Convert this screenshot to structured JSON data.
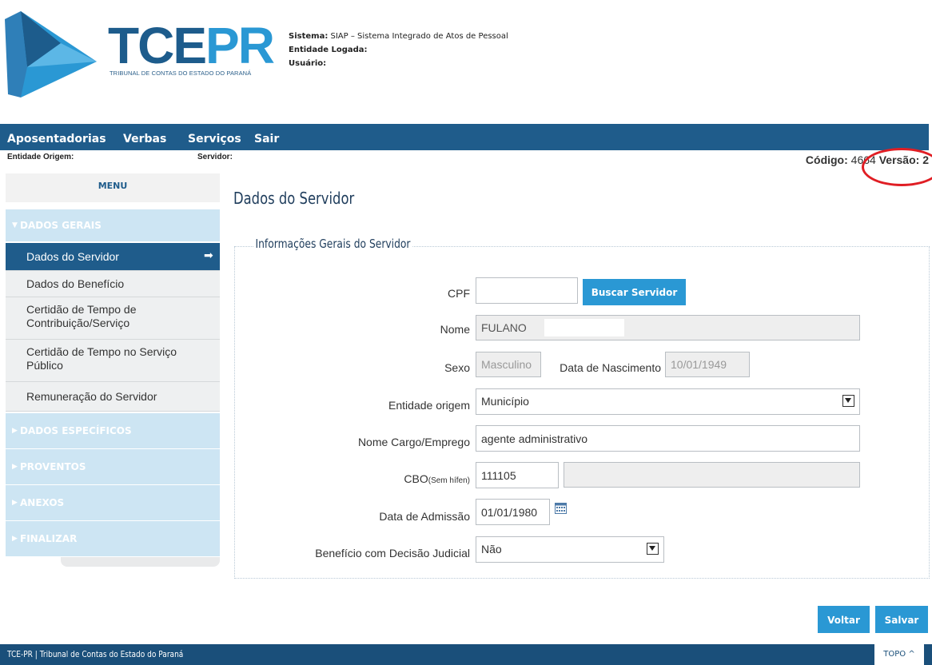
{
  "logo": {
    "text_tce": "TCE",
    "text_pr": "PR",
    "subtitle": "TRIBUNAL DE CONTAS DO ESTADO DO PARANÁ"
  },
  "system_info": {
    "sistema_label": "Sistema:",
    "sistema_value": " SIAP – Sistema Integrado de Atos de Pessoal",
    "entidade_label": "Entidade Logada:",
    "usuario_label": "Usuário:"
  },
  "nav": {
    "items": [
      "Aposentadorias",
      "Verbas",
      "Serviços",
      "Sair"
    ]
  },
  "info_bar": {
    "entidade_origem_label": "Entidade Origem:",
    "servidor_label": "Servidor:",
    "codigo_label": "Código:",
    "codigo_value": " 4664 ",
    "versao_label": "Versão:",
    "versao_value": " 2"
  },
  "sidebar": {
    "menu_title": "MENU",
    "sections": [
      {
        "label": "DADOS GERAIS",
        "expanded": true
      },
      {
        "label": "DADOS ESPECÍFICOS"
      },
      {
        "label": "PROVENTOS"
      },
      {
        "label": "ANEXOS"
      },
      {
        "label": "FINALIZAR"
      }
    ],
    "items": [
      {
        "label": "Dados do Servidor",
        "active": true
      },
      {
        "label": "Dados do Benefício"
      },
      {
        "label_line1": "Certidão de Tempo de",
        "label_line2": "Contribuição/Serviço"
      },
      {
        "label_line1": "Certidão de Tempo no Serviço",
        "label_line2": "Público"
      },
      {
        "label": "Remuneração do Servidor"
      }
    ]
  },
  "page_title": "Dados do Servidor",
  "fieldset_legend": "Informações Gerais do Servidor",
  "form": {
    "cpf": {
      "label": "CPF",
      "value": ""
    },
    "buscar_button": "Buscar Servidor",
    "nome": {
      "label": "Nome",
      "value": "FULANO"
    },
    "sexo": {
      "label": "Sexo",
      "value": "Masculino"
    },
    "nascimento": {
      "label": "Data de Nascimento",
      "value": "10/01/1949"
    },
    "entidade_origem": {
      "label": "Entidade origem",
      "value": "Município"
    },
    "cargo": {
      "label": "Nome Cargo/Emprego",
      "value": "agente administrativo"
    },
    "cbo": {
      "label": "CBO",
      "label_hint": "(Sem hífen)",
      "value": "111105",
      "description": ""
    },
    "admissao": {
      "label": "Data de Admissão",
      "value": "01/01/1980"
    },
    "decisao_judicial": {
      "label": "Benefício com Decisão Judicial",
      "value": "Não"
    }
  },
  "actions": {
    "voltar": "Voltar",
    "salvar": "Salvar"
  },
  "footer": {
    "text": "TCE-PR | Tribunal de Contas do Estado do Paraná",
    "topo": "TOPO ^"
  },
  "colors": {
    "brand_dark": "#1f5c8b",
    "brand_light": "#2a98d4",
    "sidebar_section": "#cde5f3",
    "highlight": "#e01e24"
  }
}
